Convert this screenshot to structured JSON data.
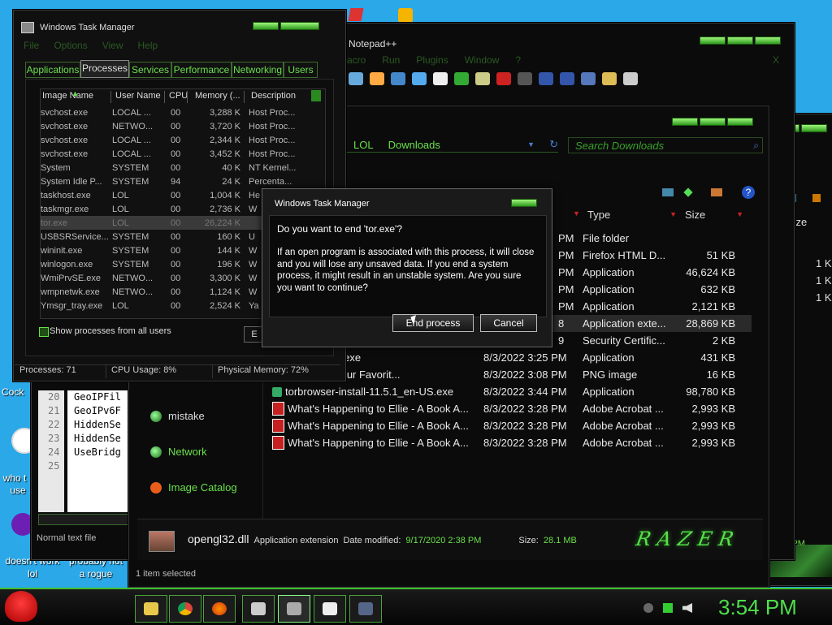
{
  "desktop": {
    "labels": [
      "Cock",
      "who t",
      "use",
      "doesn't work",
      "lol",
      "probably not",
      "a rogue"
    ]
  },
  "notepad": {
    "title": "Notepad++",
    "menu": [
      "acro",
      "Run",
      "Plugins",
      "Window",
      "?"
    ],
    "close_glyph": "X",
    "line_numbers": [
      "20",
      "21",
      "22",
      "23",
      "24",
      "25"
    ],
    "lines": [
      "GeoIPFil",
      "GeoIPv6F",
      "HiddenSe",
      "HiddenSe",
      "UseBridg",
      ""
    ],
    "status": "Normal text file"
  },
  "explorer": {
    "breadcrumb": [
      "LOL",
      "Downloads"
    ],
    "search_placeholder": "Search Downloads",
    "nav": [
      "mistake",
      "Network",
      "Image Catalog"
    ],
    "columns": {
      "type": "Type",
      "size": "Size"
    },
    "rows": [
      {
        "name": "",
        "date": "PM",
        "type": "File folder",
        "size": "",
        "icon": ""
      },
      {
        "name": "",
        "date": "PM",
        "type": "Firefox HTML D...",
        "size": "51 KB",
        "icon": ""
      },
      {
        "name": "",
        "date": "PM",
        "type": "Application",
        "size": "46,624 KB",
        "icon": ""
      },
      {
        "name": "",
        "date": "PM",
        "type": "Application",
        "size": "632 KB",
        "icon": ""
      },
      {
        "name": "",
        "date": "PM",
        "type": "Application",
        "size": "2,121 KB",
        "icon": ""
      },
      {
        "name": "",
        "date": "8",
        "type": "Application exte...",
        "size": "28,869 KB",
        "icon": ""
      },
      {
        "name": "",
        "date": "9",
        "type": "Security Certific...",
        "size": "2 KB",
        "icon": ""
      },
      {
        "name": "_webinstall_all.exe",
        "date": "8/3/2022 3:25 PM",
        "type": "Application",
        "size": "431 KB",
        "icon": ""
      },
      {
        "name": "_2022-08-03 Your Favorit...",
        "date": "8/3/2022 3:08 PM",
        "type": "PNG image",
        "size": "16 KB",
        "icon": ""
      },
      {
        "name": "torbrowser-install-11.5.1_en-US.exe",
        "date": "8/3/2022 3:44 PM",
        "type": "Application",
        "size": "98,780 KB",
        "icon": "exe"
      },
      {
        "name": "What's Happening to Ellie - A Book A...",
        "date": "8/3/2022 3:28 PM",
        "type": "Adobe Acrobat ...",
        "size": "2,993 KB",
        "icon": "pdf"
      },
      {
        "name": "What's Happening to Ellie - A Book A...",
        "date": "8/3/2022 3:28 PM",
        "type": "Adobe Acrobat ...",
        "size": "2,993 KB",
        "icon": "pdf"
      },
      {
        "name": "What's Happening to Ellie - A Book A...",
        "date": "8/3/2022 3:28 PM",
        "type": "Adobe Acrobat ...",
        "size": "2,993 KB",
        "icon": "pdf"
      }
    ],
    "details": {
      "filename": "opengl32.dll",
      "type": "Application extension",
      "date_label": "Date modified:",
      "date": "9/17/2020 2:38 PM",
      "size_label": "Size:",
      "size": "28.1 MB",
      "brand": "RAZER"
    },
    "status": "1 item selected"
  },
  "back_window": {
    "size_label": "Size",
    "sizes": [
      "1 K",
      "1 K",
      "1 K"
    ],
    "time": "3:49 PM"
  },
  "taskmgr": {
    "title": "Windows Task Manager",
    "menu": [
      "File",
      "Options",
      "View",
      "Help"
    ],
    "tabs": [
      "Applications",
      "Processes",
      "Services",
      "Performance",
      "Networking",
      "Users"
    ],
    "columns": [
      "Image Name",
      "User Name",
      "CPU",
      "Memory (...",
      "Description"
    ],
    "processes": [
      [
        "svchost.exe",
        "LOCAL ...",
        "00",
        "3,288 K",
        "Host Proc..."
      ],
      [
        "svchost.exe",
        "NETWO...",
        "00",
        "3,720 K",
        "Host Proc..."
      ],
      [
        "svchost.exe",
        "LOCAL ...",
        "00",
        "2,344 K",
        "Host Proc..."
      ],
      [
        "svchost.exe",
        "LOCAL ...",
        "00",
        "3,452 K",
        "Host Proc..."
      ],
      [
        "System",
        "SYSTEM",
        "00",
        "40 K",
        "NT Kernel..."
      ],
      [
        "System Idle P...",
        "SYSTEM",
        "94",
        "24 K",
        "Percenta..."
      ],
      [
        "taskhost.exe",
        "LOL",
        "00",
        "1,004 K",
        "He"
      ],
      [
        "taskmgr.exe",
        "LOL",
        "00",
        "2,736 K",
        "W"
      ],
      [
        "tor.exe",
        "LOL",
        "00",
        "26,224 K",
        ""
      ],
      [
        "USBSRService...",
        "SYSTEM",
        "00",
        "160 K",
        "U"
      ],
      [
        "wininit.exe",
        "SYSTEM",
        "00",
        "144 K",
        "W"
      ],
      [
        "winlogon.exe",
        "SYSTEM",
        "00",
        "196 K",
        "W"
      ],
      [
        "WmiPrvSE.exe",
        "NETWO...",
        "00",
        "3,300 K",
        "W"
      ],
      [
        "wmpnetwk.exe",
        "NETWO...",
        "00",
        "1,124 K",
        "W"
      ],
      [
        "Ymsgr_tray.exe",
        "LOL",
        "00",
        "2,524 K",
        "Ya"
      ]
    ],
    "show_all": "Show processes from all users",
    "end_btn": "E",
    "status": {
      "processes": "Processes: 71",
      "cpu": "CPU Usage: 8%",
      "memory": "Physical Memory: 72%"
    }
  },
  "dialog": {
    "title": "Windows Task Manager",
    "question": "Do you want to end 'tor.exe'?",
    "body": "If an open program is associated with this process, it will close and you will lose any unsaved data. If you end a system process, it might result in an unstable system. Are you sure you want to continue?",
    "confirm": "End process",
    "cancel": "Cancel"
  },
  "taskbar": {
    "clock": "3:54 PM"
  }
}
